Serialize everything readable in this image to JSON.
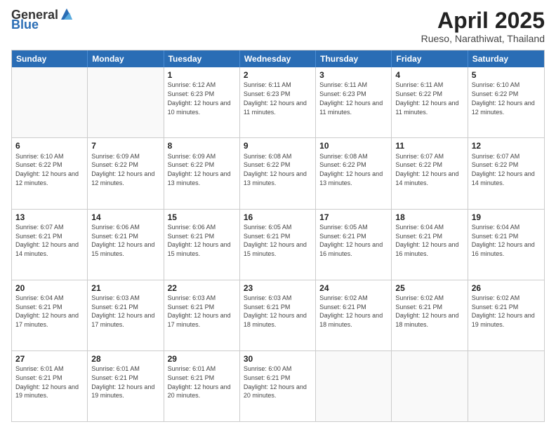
{
  "logo": {
    "general": "General",
    "blue": "Blue"
  },
  "title": {
    "month": "April 2025",
    "location": "Rueso, Narathiwat, Thailand"
  },
  "header": {
    "days": [
      "Sunday",
      "Monday",
      "Tuesday",
      "Wednesday",
      "Thursday",
      "Friday",
      "Saturday"
    ]
  },
  "weeks": [
    [
      {
        "day": "",
        "info": ""
      },
      {
        "day": "",
        "info": ""
      },
      {
        "day": "1",
        "info": "Sunrise: 6:12 AM\nSunset: 6:23 PM\nDaylight: 12 hours and 10 minutes."
      },
      {
        "day": "2",
        "info": "Sunrise: 6:11 AM\nSunset: 6:23 PM\nDaylight: 12 hours and 11 minutes."
      },
      {
        "day": "3",
        "info": "Sunrise: 6:11 AM\nSunset: 6:23 PM\nDaylight: 12 hours and 11 minutes."
      },
      {
        "day": "4",
        "info": "Sunrise: 6:11 AM\nSunset: 6:22 PM\nDaylight: 12 hours and 11 minutes."
      },
      {
        "day": "5",
        "info": "Sunrise: 6:10 AM\nSunset: 6:22 PM\nDaylight: 12 hours and 12 minutes."
      }
    ],
    [
      {
        "day": "6",
        "info": "Sunrise: 6:10 AM\nSunset: 6:22 PM\nDaylight: 12 hours and 12 minutes."
      },
      {
        "day": "7",
        "info": "Sunrise: 6:09 AM\nSunset: 6:22 PM\nDaylight: 12 hours and 12 minutes."
      },
      {
        "day": "8",
        "info": "Sunrise: 6:09 AM\nSunset: 6:22 PM\nDaylight: 12 hours and 13 minutes."
      },
      {
        "day": "9",
        "info": "Sunrise: 6:08 AM\nSunset: 6:22 PM\nDaylight: 12 hours and 13 minutes."
      },
      {
        "day": "10",
        "info": "Sunrise: 6:08 AM\nSunset: 6:22 PM\nDaylight: 12 hours and 13 minutes."
      },
      {
        "day": "11",
        "info": "Sunrise: 6:07 AM\nSunset: 6:22 PM\nDaylight: 12 hours and 14 minutes."
      },
      {
        "day": "12",
        "info": "Sunrise: 6:07 AM\nSunset: 6:22 PM\nDaylight: 12 hours and 14 minutes."
      }
    ],
    [
      {
        "day": "13",
        "info": "Sunrise: 6:07 AM\nSunset: 6:21 PM\nDaylight: 12 hours and 14 minutes."
      },
      {
        "day": "14",
        "info": "Sunrise: 6:06 AM\nSunset: 6:21 PM\nDaylight: 12 hours and 15 minutes."
      },
      {
        "day": "15",
        "info": "Sunrise: 6:06 AM\nSunset: 6:21 PM\nDaylight: 12 hours and 15 minutes."
      },
      {
        "day": "16",
        "info": "Sunrise: 6:05 AM\nSunset: 6:21 PM\nDaylight: 12 hours and 15 minutes."
      },
      {
        "day": "17",
        "info": "Sunrise: 6:05 AM\nSunset: 6:21 PM\nDaylight: 12 hours and 16 minutes."
      },
      {
        "day": "18",
        "info": "Sunrise: 6:04 AM\nSunset: 6:21 PM\nDaylight: 12 hours and 16 minutes."
      },
      {
        "day": "19",
        "info": "Sunrise: 6:04 AM\nSunset: 6:21 PM\nDaylight: 12 hours and 16 minutes."
      }
    ],
    [
      {
        "day": "20",
        "info": "Sunrise: 6:04 AM\nSunset: 6:21 PM\nDaylight: 12 hours and 17 minutes."
      },
      {
        "day": "21",
        "info": "Sunrise: 6:03 AM\nSunset: 6:21 PM\nDaylight: 12 hours and 17 minutes."
      },
      {
        "day": "22",
        "info": "Sunrise: 6:03 AM\nSunset: 6:21 PM\nDaylight: 12 hours and 17 minutes."
      },
      {
        "day": "23",
        "info": "Sunrise: 6:03 AM\nSunset: 6:21 PM\nDaylight: 12 hours and 18 minutes."
      },
      {
        "day": "24",
        "info": "Sunrise: 6:02 AM\nSunset: 6:21 PM\nDaylight: 12 hours and 18 minutes."
      },
      {
        "day": "25",
        "info": "Sunrise: 6:02 AM\nSunset: 6:21 PM\nDaylight: 12 hours and 18 minutes."
      },
      {
        "day": "26",
        "info": "Sunrise: 6:02 AM\nSunset: 6:21 PM\nDaylight: 12 hours and 19 minutes."
      }
    ],
    [
      {
        "day": "27",
        "info": "Sunrise: 6:01 AM\nSunset: 6:21 PM\nDaylight: 12 hours and 19 minutes."
      },
      {
        "day": "28",
        "info": "Sunrise: 6:01 AM\nSunset: 6:21 PM\nDaylight: 12 hours and 19 minutes."
      },
      {
        "day": "29",
        "info": "Sunrise: 6:01 AM\nSunset: 6:21 PM\nDaylight: 12 hours and 20 minutes."
      },
      {
        "day": "30",
        "info": "Sunrise: 6:00 AM\nSunset: 6:21 PM\nDaylight: 12 hours and 20 minutes."
      },
      {
        "day": "",
        "info": ""
      },
      {
        "day": "",
        "info": ""
      },
      {
        "day": "",
        "info": ""
      }
    ]
  ]
}
